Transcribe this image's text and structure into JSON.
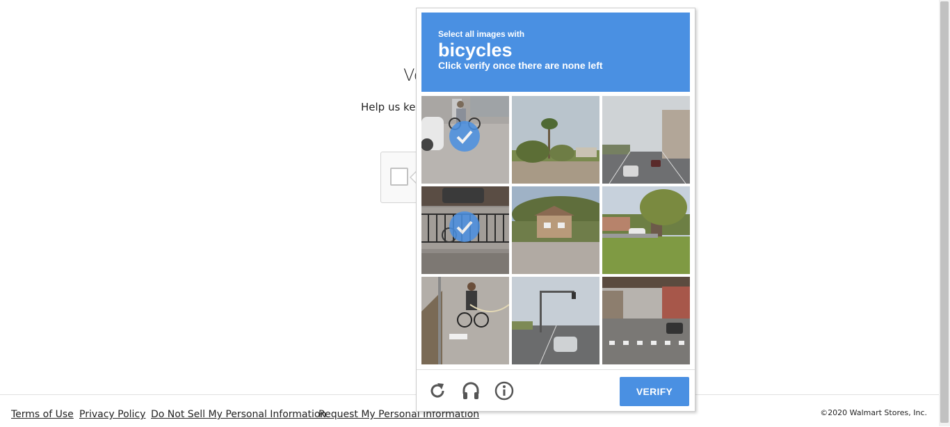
{
  "page": {
    "heading": "Ve",
    "subtext": "Help us kee"
  },
  "challenge": {
    "instruction_line1": "Select all images with",
    "target": "bicycles",
    "instruction_line3": "Click verify once there are none left",
    "verify_label": "VERIFY",
    "accent_color": "#4a90e2",
    "tiles": [
      {
        "scene": "cyclist-by-car",
        "selected": true
      },
      {
        "scene": "palm-trees-house",
        "selected": false
      },
      {
        "scene": "city-street-traffic",
        "selected": false
      },
      {
        "scene": "bike-by-fence",
        "selected": true
      },
      {
        "scene": "hillside-houses",
        "selected": false
      },
      {
        "scene": "residential-lawn",
        "selected": false
      },
      {
        "scene": "cyclist-on-road",
        "selected": false
      },
      {
        "scene": "intersection-car",
        "selected": false
      },
      {
        "scene": "crosswalk-underpass",
        "selected": false
      }
    ],
    "icons": [
      "reload-icon",
      "audio-headphones-icon",
      "info-icon"
    ]
  },
  "footer": {
    "links": [
      "Terms of Use",
      "Privacy Policy",
      "Do Not Sell My Personal Information",
      "Request My Personal Information"
    ],
    "copyright": "©2020 Walmart Stores, Inc."
  }
}
